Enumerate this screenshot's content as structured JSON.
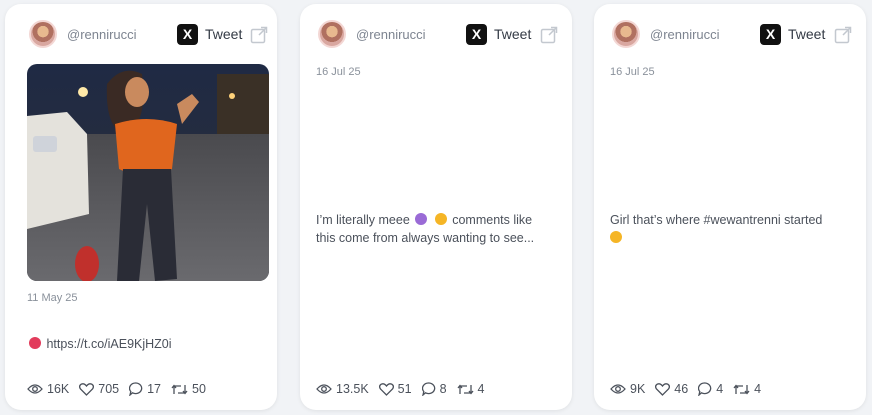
{
  "cards": [
    {
      "handle": "@rennirucci",
      "tweet_label": "Tweet",
      "date": "11 May 25",
      "text": "https://t.co/iAE9KjHZ0i",
      "stats": {
        "views": "16K",
        "likes": "705",
        "replies": "17",
        "retweets": "50"
      }
    },
    {
      "handle": "@rennirucci",
      "tweet_label": "Tweet",
      "date": "16 Jul 25",
      "text_line1": "I’m literally meee",
      "text_line1b": "comments like",
      "text_line2": "this come from always wanting to see...",
      "stats": {
        "views": "13.5K",
        "likes": "51",
        "replies": "8",
        "retweets": "4"
      }
    },
    {
      "handle": "@rennirucci",
      "tweet_label": "Tweet",
      "date": "16 Jul 25",
      "text": "Girl that’s where #wewantrenni started",
      "stats": {
        "views": "9K",
        "likes": "46",
        "replies": "4",
        "retweets": "4"
      }
    }
  ],
  "icons": {
    "x_logo": "x-logo-icon",
    "external": "external-link-icon",
    "views": "eye-icon",
    "likes": "heart-icon",
    "replies": "comment-icon",
    "retweets": "retweet-icon"
  },
  "colors": {
    "background": "#f1f3f6",
    "card": "#ffffff",
    "muted_text": "#8a919b",
    "body_text": "#4b515b"
  }
}
